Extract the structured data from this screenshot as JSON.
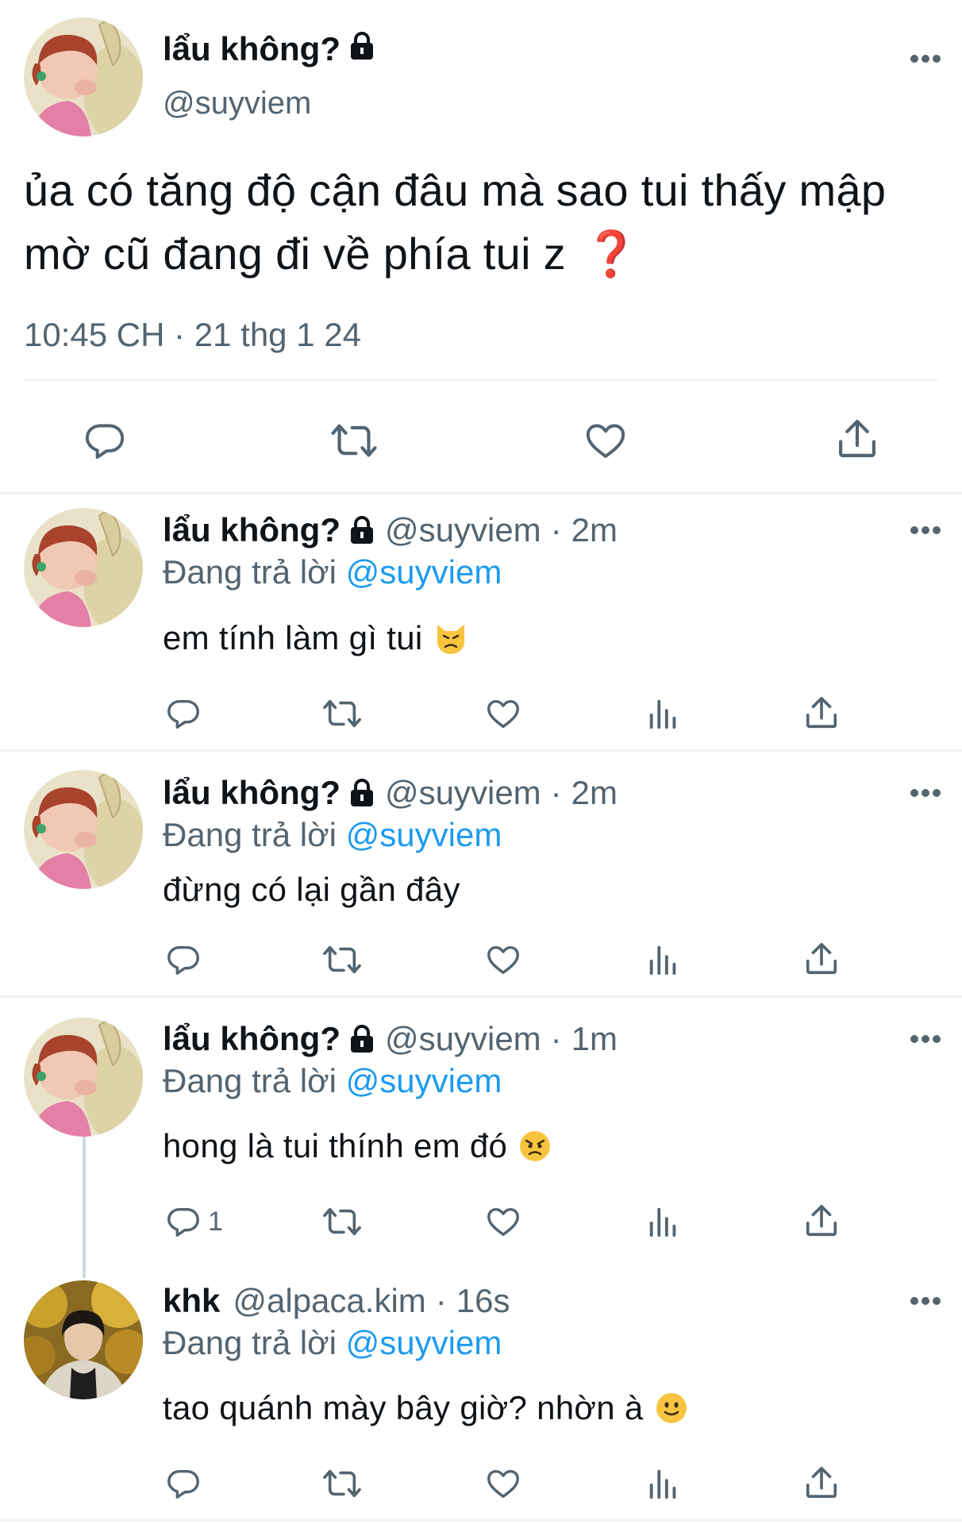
{
  "main_tweet": {
    "display_name": "lẩu không?",
    "handle": "@suyviem",
    "text": "ủa có tăng độ cận đâu mà sao tui thấy mập mờ cũ đang đi về phía tui z",
    "emoji": "❓",
    "timestamp": "10:45 CH · 21 thg 1 24"
  },
  "replies": [
    {
      "display_name": "lẩu không?",
      "handle": "@suyviem",
      "sep": "·",
      "time": "2m",
      "replying_label": "Đang trả lời",
      "replying_to": "@suyviem",
      "text": "em tính làm gì tui",
      "emoji": "cat-pouting-emoji",
      "reply_count": ""
    },
    {
      "display_name": "lẩu không?",
      "handle": "@suyviem",
      "sep": "·",
      "time": "2m",
      "replying_label": "Đang trả lời",
      "replying_to": "@suyviem",
      "text": "đừng có lại gần đây",
      "emoji": "",
      "reply_count": ""
    },
    {
      "display_name": "lẩu không?",
      "handle": "@suyviem",
      "sep": "·",
      "time": "1m",
      "replying_label": "Đang trả lời",
      "replying_to": "@suyviem",
      "text": "hong là tui thính em đó",
      "emoji": "angry-face-emoji",
      "reply_count": "1"
    },
    {
      "display_name": "khk",
      "handle": "@alpaca.kim",
      "sep": "·",
      "time": "16s",
      "replying_label": "Đang trả lời",
      "replying_to": "@suyviem",
      "text": "tao quánh mày bây giờ? nhờn à",
      "emoji": "slightly-smiling-face-emoji",
      "reply_count": ""
    }
  ],
  "colors": {
    "text": "#0f1419",
    "secondary": "#536471",
    "mention": "#1d9bf0",
    "divider": "#eff3f4",
    "thread_line": "#cfd9de"
  },
  "icons": [
    "reply-icon",
    "retweet-icon",
    "like-icon",
    "views-icon",
    "share-icon",
    "more-icon",
    "lock-icon"
  ]
}
